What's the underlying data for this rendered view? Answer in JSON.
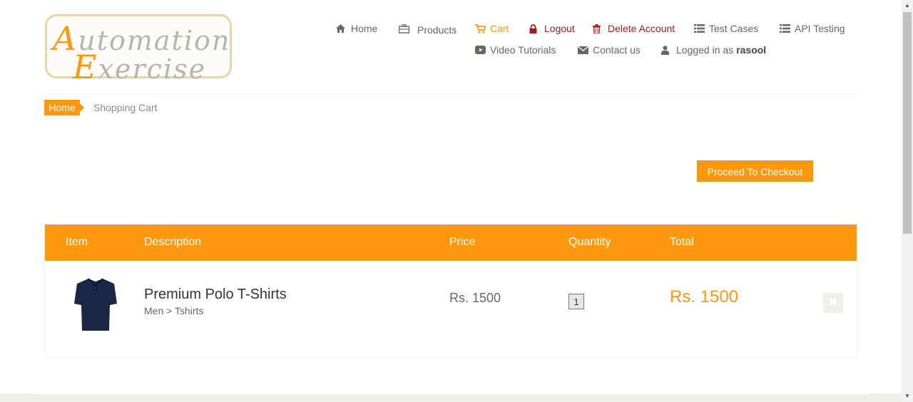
{
  "logo": {
    "line1_cap": "A",
    "line1_rest": "utomation",
    "line2_cap": "E",
    "line2_rest": "xercise"
  },
  "nav": {
    "home": "Home",
    "products": "Products",
    "cart": "Cart",
    "logout": "Logout",
    "delete_account": "Delete Account",
    "test_cases": "Test Cases",
    "api_testing": "API Testing",
    "video_tutorials": "Video Tutorials",
    "contact_us": "Contact us",
    "logged_in_prefix": "Logged in as",
    "username": "rasool"
  },
  "breadcrumb": {
    "home": "Home",
    "current": "Shopping Cart"
  },
  "checkout_label": "Proceed To Checkout",
  "table": {
    "headers": {
      "item": "Item",
      "description": "Description",
      "price": "Price",
      "quantity": "Quantity",
      "total": "Total"
    },
    "rows": [
      {
        "name": "Premium Polo T-Shirts",
        "category": "Men > Tshirts",
        "price": "Rs. 1500",
        "quantity": "1",
        "total": "Rs. 1500"
      }
    ]
  },
  "colors": {
    "accent": "#fe980f",
    "danger": "#a01e1e",
    "text": "#696763"
  }
}
